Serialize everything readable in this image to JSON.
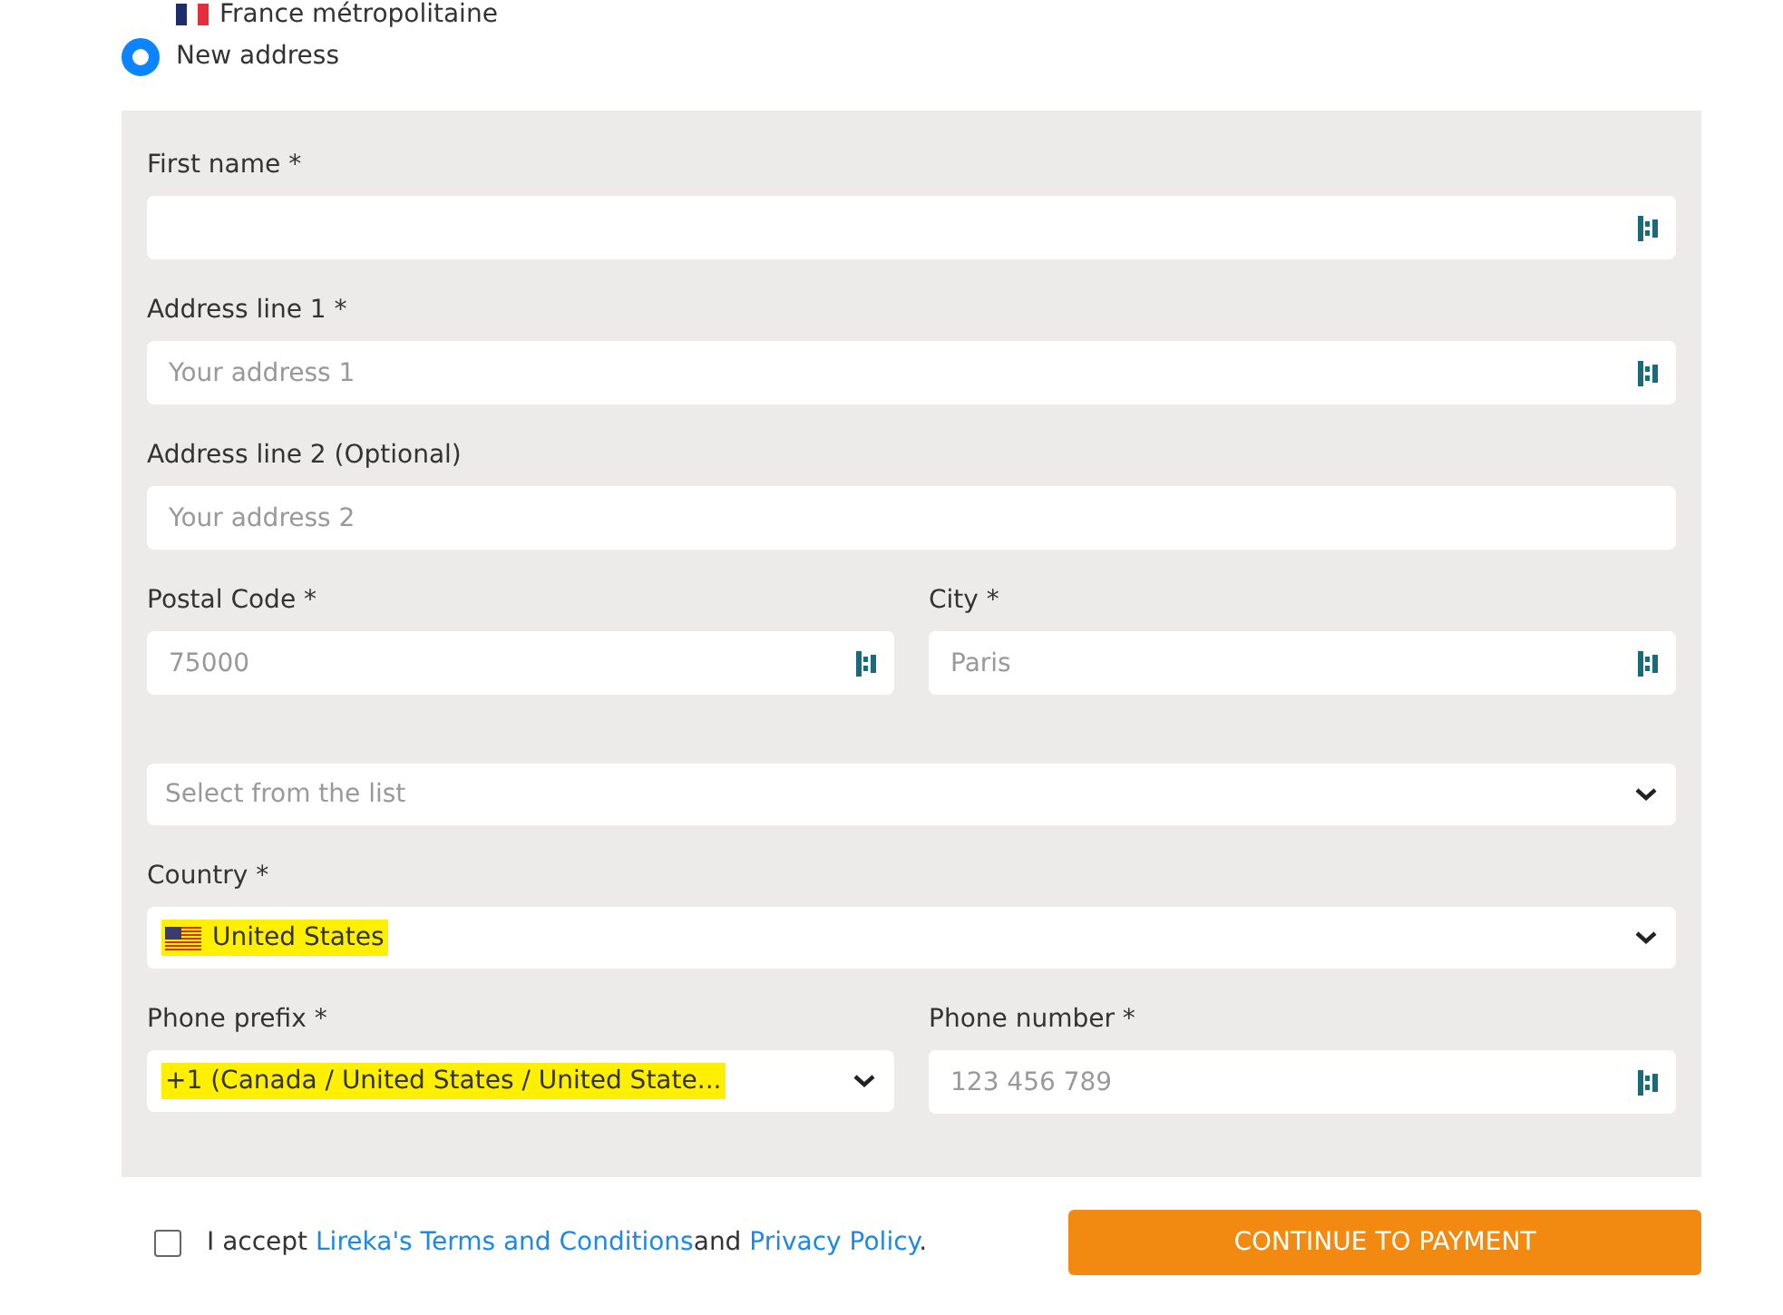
{
  "saved_address": {
    "label": "France métropolitaine"
  },
  "new_address": {
    "label": "New address",
    "selected": true
  },
  "form_rows": [
    {
      "fields": [
        {
          "kind": "text",
          "label": "First name *",
          "autofill_icon": true
        }
      ]
    },
    {
      "fields": [
        {
          "kind": "text",
          "label": "Address line 1 *",
          "placeholder": "Your address 1",
          "autofill_icon": true
        }
      ]
    },
    {
      "fields": [
        {
          "kind": "text",
          "label": "Address line 2 (Optional)",
          "placeholder": "Your address 2",
          "autofill_icon": false
        }
      ]
    },
    {
      "fields": [
        {
          "kind": "text",
          "label": "Postal Code *",
          "placeholder": "75000",
          "autofill_icon": true
        },
        {
          "kind": "text",
          "label": "City *",
          "placeholder": "Paris",
          "autofill_icon": true
        }
      ]
    },
    {
      "fields": [
        {
          "kind": "select",
          "placeholder": "Select from the list",
          "highlighted": false
        }
      ]
    },
    {
      "fields": [
        {
          "kind": "select",
          "label": "Country *",
          "value": "United States",
          "flag": true,
          "highlighted": true
        }
      ]
    },
    {
      "fields": [
        {
          "kind": "select",
          "label": "Phone prefix *",
          "value": "+1 (Canada / United States / United State...",
          "highlighted": true
        },
        {
          "kind": "text",
          "label": "Phone number *",
          "placeholder": "123 456 789",
          "autofill_icon": true
        }
      ]
    }
  ],
  "terms": {
    "checked": false,
    "prefix": "I accept ",
    "link_terms": "Lireka's Terms and Conditions",
    "middle": "and ",
    "link_privacy": "Privacy Policy",
    "suffix": "."
  },
  "submit_button": "CONTINUE TO PAYMENT"
}
